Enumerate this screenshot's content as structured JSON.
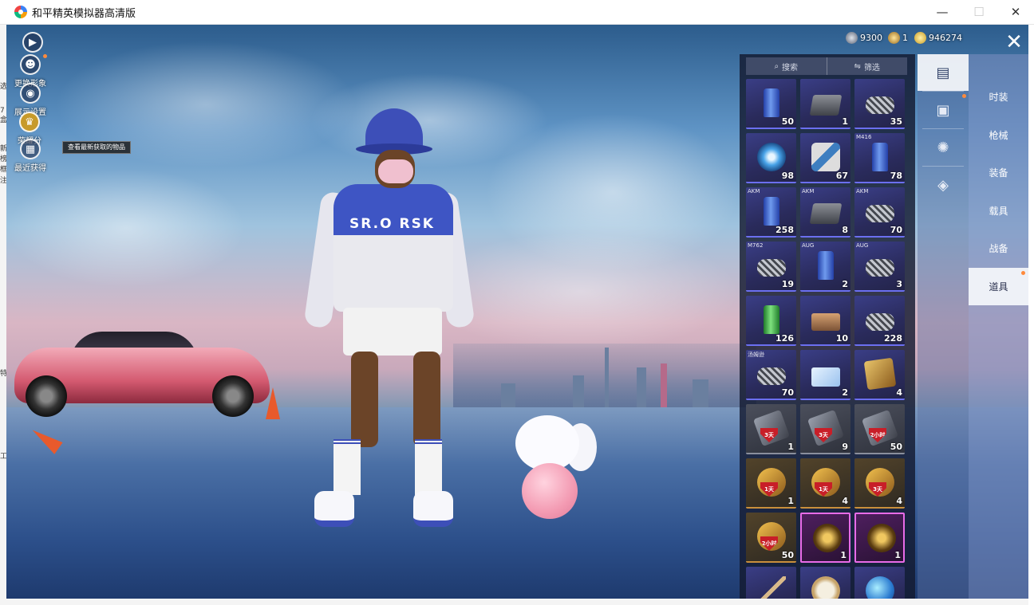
{
  "window": {
    "title": "和平精英模拟器高清版",
    "minimize": "—",
    "maximize": "☐",
    "close": "✕"
  },
  "bg_strip": [
    "选",
    "7",
    "盒",
    "新",
    "榜",
    "框",
    "注",
    "特",
    "工"
  ],
  "side_menu": [
    {
      "name": "play-button",
      "icon": "▶",
      "label": ""
    },
    {
      "name": "change-look-button",
      "icon": "☻",
      "label": "更换形象"
    },
    {
      "name": "display-settings-button",
      "icon": "◉",
      "label": "展示设置"
    },
    {
      "name": "club-button",
      "icon": "♛",
      "label": "荣耀分"
    },
    {
      "name": "recent-button",
      "icon": "▦",
      "label": "最近获得"
    }
  ],
  "tooltip": "查看最新获取的物品",
  "currency": [
    {
      "name": "currency-bullet",
      "value": "9300",
      "color": "#9aa3b5"
    },
    {
      "name": "currency-gold-token",
      "value": "1",
      "color": "#d8a64a"
    },
    {
      "name": "currency-coin",
      "value": "946274",
      "color": "#e8c44a"
    }
  ],
  "close_glyph": "✕",
  "inventory": {
    "search_label": "搜索",
    "filter_label": "筛选",
    "items": [
      {
        "icon": "i-can",
        "tag": "",
        "qty": "50",
        "style": ""
      },
      {
        "icon": "i-box",
        "tag": "",
        "qty": "1",
        "style": ""
      },
      {
        "icon": "i-spring",
        "tag": "",
        "qty": "35",
        "style": ""
      },
      {
        "icon": "i-disc",
        "tag": "",
        "qty": "98",
        "style": ""
      },
      {
        "icon": "i-kit",
        "tag": "",
        "qty": "67",
        "style": ""
      },
      {
        "icon": "i-can",
        "tag": "M416",
        "qty": "78",
        "style": ""
      },
      {
        "icon": "i-can",
        "tag": "AKM",
        "qty": "258",
        "style": ""
      },
      {
        "icon": "i-box",
        "tag": "AKM",
        "qty": "8",
        "style": ""
      },
      {
        "icon": "i-spring",
        "tag": "AKM",
        "qty": "70",
        "style": ""
      },
      {
        "icon": "i-spring",
        "tag": "M762",
        "qty": "19",
        "style": ""
      },
      {
        "icon": "i-can",
        "tag": "AUG",
        "qty": "2",
        "style": ""
      },
      {
        "icon": "i-spring",
        "tag": "AUG",
        "qty": "3",
        "style": ""
      },
      {
        "icon": "i-can-green",
        "tag": "",
        "qty": "126",
        "style": ""
      },
      {
        "icon": "i-tray",
        "tag": "",
        "qty": "10",
        "style": ""
      },
      {
        "icon": "i-spring",
        "tag": "",
        "qty": "228",
        "style": ""
      },
      {
        "icon": "i-spring",
        "tag": "汤姆逊",
        "qty": "70",
        "style": ""
      },
      {
        "icon": "i-card",
        "tag": "",
        "qty": "2",
        "style": ""
      },
      {
        "icon": "i-id",
        "tag": "",
        "qty": "4",
        "style": ""
      },
      {
        "icon": "i-ticket",
        "tag": "",
        "qty": "1",
        "style": "gray",
        "badge": "3天"
      },
      {
        "icon": "i-ticket",
        "tag": "",
        "qty": "9",
        "style": "gray",
        "badge": "3天"
      },
      {
        "icon": "i-ticket",
        "tag": "",
        "qty": "50",
        "style": "gray",
        "badge": "2小时"
      },
      {
        "icon": "i-ticket-gold",
        "tag": "",
        "qty": "1",
        "style": "gold",
        "badge": "1天"
      },
      {
        "icon": "i-ticket-gold",
        "tag": "",
        "qty": "4",
        "style": "gold",
        "badge": "1天"
      },
      {
        "icon": "i-ticket-gold",
        "tag": "",
        "qty": "4",
        "style": "gold",
        "badge": "3天"
      },
      {
        "icon": "i-ticket-gold",
        "tag": "",
        "qty": "50",
        "style": "gold",
        "badge": "2小时"
      },
      {
        "icon": "i-lion",
        "tag": "",
        "qty": "1",
        "style": "purple purple-hl"
      },
      {
        "icon": "i-lion",
        "tag": "",
        "qty": "1",
        "style": "purple purple-hl"
      },
      {
        "icon": "i-stick",
        "tag": "",
        "qty": "",
        "style": ""
      },
      {
        "icon": "i-compass",
        "tag": "",
        "qty": "",
        "style": ""
      },
      {
        "icon": "i-orb",
        "tag": "",
        "qty": "",
        "style": ""
      }
    ]
  },
  "categories": [
    {
      "name": "category-fashion-icon",
      "glyph": "▤",
      "active": true,
      "dot": false
    },
    {
      "name": "category-box-icon",
      "glyph": "▣",
      "active": false,
      "dot": true
    },
    {
      "name": "category-firework-icon",
      "glyph": "✺",
      "active": false,
      "dot": false
    },
    {
      "name": "category-ticket-icon",
      "glyph": "◈",
      "active": false,
      "dot": false
    }
  ],
  "tabs": [
    {
      "label": "时装",
      "active": false,
      "dot": false
    },
    {
      "label": "枪械",
      "active": false,
      "dot": false
    },
    {
      "label": "装备",
      "active": false,
      "dot": false
    },
    {
      "label": "载具",
      "active": false,
      "dot": false
    },
    {
      "label": "战备",
      "active": false,
      "dot": false
    },
    {
      "label": "道具",
      "active": true,
      "dot": true
    }
  ],
  "character": {
    "shirt_text": "SR.O  RSK"
  }
}
